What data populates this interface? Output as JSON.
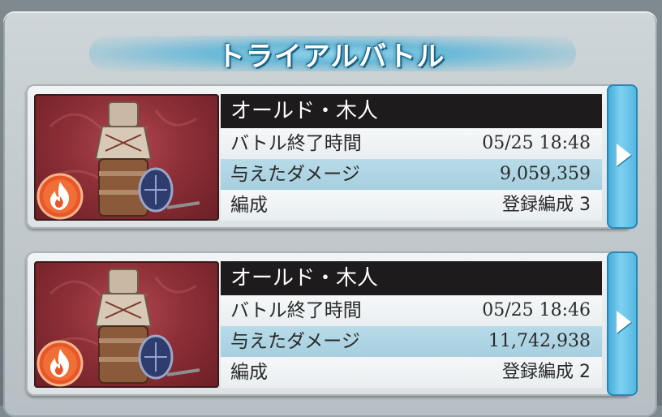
{
  "header": {
    "title": "トライアルバトル"
  },
  "battles": [
    {
      "name": "オールド・木人",
      "end_time_label": "バトル終了時間",
      "end_time_value": "05/25 18:48",
      "damage_label": "与えたダメージ",
      "damage_value": "9,059,359",
      "party_label": "編成",
      "party_value": "登録編成 3",
      "element_icon": "fire-icon"
    },
    {
      "name": "オールド・木人",
      "end_time_label": "バトル終了時間",
      "end_time_value": "05/25 18:46",
      "damage_label": "与えたダメージ",
      "damage_value": "11,742,938",
      "party_label": "編成",
      "party_value": "登録編成 2",
      "element_icon": "fire-icon"
    }
  ],
  "colors": {
    "accent": "#4fb5e0",
    "name_bar": "#1d1b1c",
    "portrait_bg": "#8e2f37",
    "fire": "#e8562a"
  }
}
